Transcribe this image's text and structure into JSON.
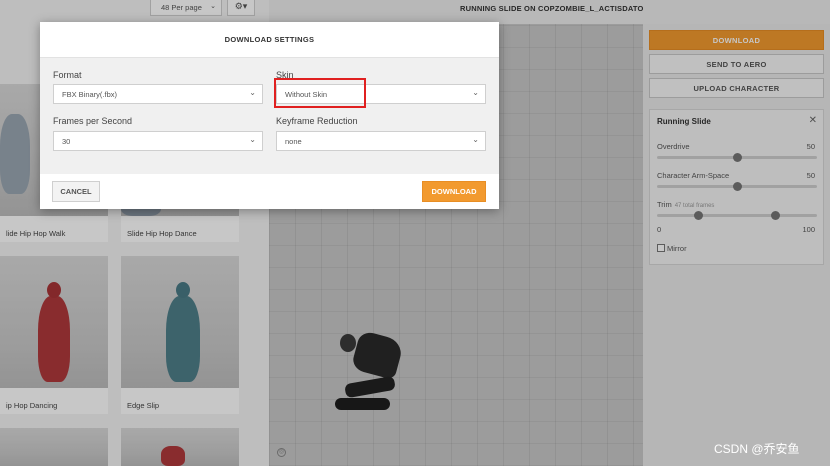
{
  "library": {
    "per_page": "48 Per page",
    "per_page_caret": "⌄",
    "gear": "⚙▾",
    "cards": [
      {
        "label": "lide Hip Hop Walk"
      },
      {
        "label": "Slide Hip Hop Dance"
      },
      {
        "label": "ip Hop Dancing"
      },
      {
        "label": "Edge Slip"
      }
    ]
  },
  "viewport": {
    "animation_title": "RUNNING SLIDE ON COPZOMBIE_L_ACTISDATO"
  },
  "right_panel": {
    "download": "DOWNLOAD",
    "send_to_aero": "SEND TO AERO",
    "upload_character": "UPLOAD CHARACTER",
    "slide": {
      "title": "Running Slide",
      "close": "✕",
      "overdrive_label": "Overdrive",
      "overdrive_value": "50",
      "overdrive_level": 0.5,
      "arm_space_label": "Character Arm-Space",
      "arm_space_value": "50",
      "arm_space_level": 0.5,
      "trim_label": "Trim",
      "trim_sub": "47 total frames",
      "trim_min": "0",
      "trim_max": "100",
      "trim_range": [
        0.26,
        0.74
      ],
      "mirror_label": "Mirror"
    }
  },
  "modal": {
    "title": "DOWNLOAD SETTINGS",
    "format_label": "Format",
    "format_value": "FBX Binary(.fbx)",
    "skin_label": "Skin",
    "skin_value": "Without Skin",
    "fps_label": "Frames per Second",
    "fps_value": "30",
    "keyframe_label": "Keyframe Reduction",
    "keyframe_value": "none",
    "chevron": "⌄",
    "cancel": "CANCEL",
    "download": "DOWNLOAD"
  },
  "colors": {
    "accent": "#f29a2f",
    "highlight": "#e02020"
  },
  "watermark": "CSDN @乔安鱼"
}
